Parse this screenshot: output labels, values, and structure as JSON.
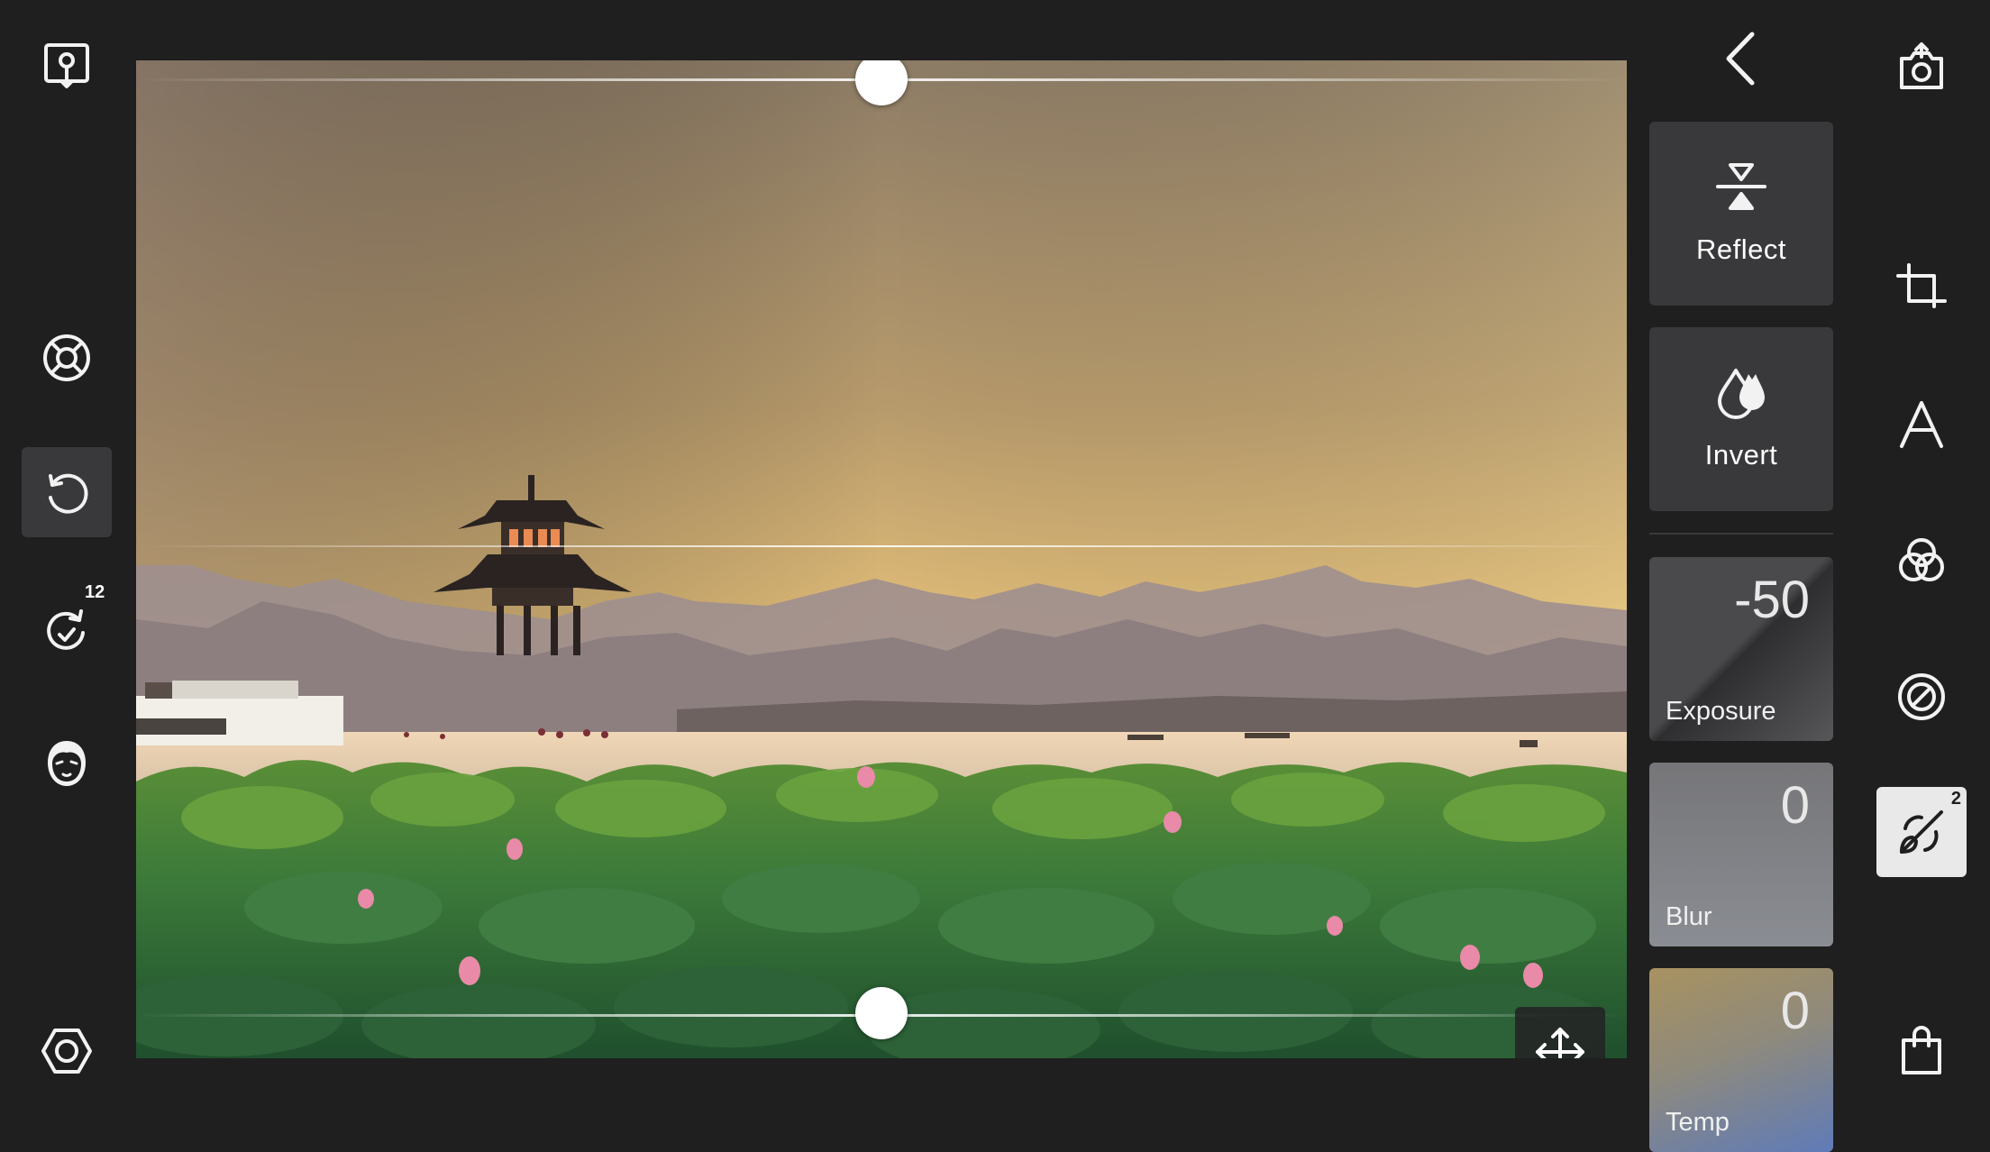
{
  "left_toolbar": {
    "redo_count": "12"
  },
  "photo": {
    "top_handle_position": 0.5,
    "bottom_handle_position": 0.5
  },
  "tools": {
    "reflect_label": "Reflect",
    "invert_label": "Invert"
  },
  "adjustments": [
    {
      "label": "Exposure",
      "value": "-50"
    },
    {
      "label": "Blur",
      "value": "0"
    },
    {
      "label": "Temp",
      "value": "0"
    }
  ],
  "right_toolbar": {
    "mask_count": "2"
  },
  "colors": {
    "background": "#1f1f20",
    "card": "#39393b",
    "active_tool": "#e9e9ea"
  }
}
